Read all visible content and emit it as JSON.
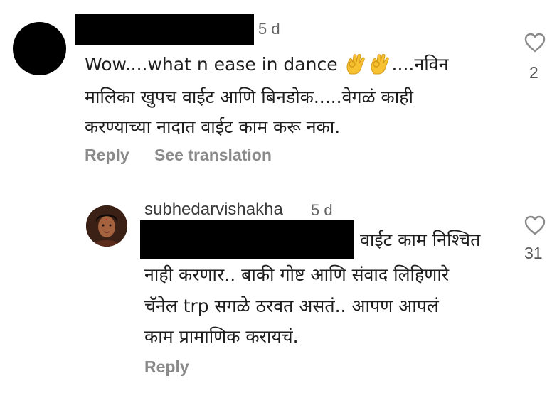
{
  "comments": [
    {
      "time": "5 d",
      "text_lines": [
        "Wow....what n ease in dance",
        "....नविन",
        "मालिका खुपच वाईट आणि बिनडोक.....वेगळं काही",
        "करण्याच्या नादात वाईट काम करू नका."
      ],
      "emoji": [
        "ok-hand-emoji",
        "ok-hand-emoji"
      ],
      "actions": {
        "reply": "Reply",
        "translate": "See translation"
      },
      "likes": "2",
      "avatar": "redacted-avatar"
    },
    {
      "username": "subhedarvishakha",
      "time": "5 d",
      "text_lines": [
        "वाईट काम निश्चित",
        "नाही करणार.. बाकी गोष्ट आणि संवाद लिहिणारे",
        "चॅनेल trp सगळे ठरवत असतं.. आपण आपलं",
        "काम प्रामाणिक करायचं."
      ],
      "actions": {
        "reply": "Reply"
      },
      "likes": "31",
      "avatar": "profile-photo"
    }
  ],
  "colors": {
    "text": "#1e1e1e",
    "muted": "#8a8a8a",
    "redaction": "#000000",
    "background": "#ffffff",
    "emoji": "#f7c232"
  },
  "icons": {
    "like": "heart-outline-icon",
    "emoji": "ok-hand-emoji"
  }
}
